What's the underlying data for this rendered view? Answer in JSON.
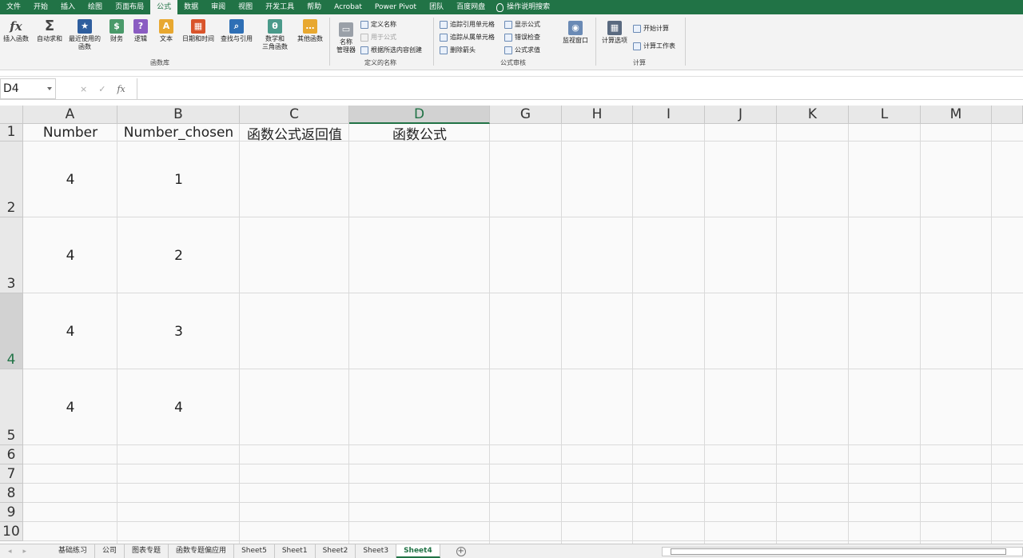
{
  "menubar": {
    "items": [
      "文件",
      "开始",
      "插入",
      "绘图",
      "页面布局",
      "公式",
      "数据",
      "审阅",
      "视图",
      "开发工具",
      "帮助",
      "Acrobat",
      "Power Pivot",
      "团队",
      "百度网盘"
    ],
    "active_index": 5,
    "tell_me": "操作说明搜索"
  },
  "ribbon": {
    "function_library": {
      "insert_function": "插入函数",
      "autosum": "自动求和",
      "recent_line1": "最近使用的",
      "recent_line2": "函数",
      "financial": "财务",
      "logical": "逻辑",
      "text": "文本",
      "datetime": "日期和时间",
      "lookup": "查找与引用",
      "math_line1": "数学和",
      "math_line2": "三角函数",
      "more": "其他函数",
      "group_label": "函数库"
    },
    "defined_names": {
      "name_manager_line1": "名称",
      "name_manager_line2": "管理器",
      "define_name": "定义名称",
      "use_in_formula": "用于公式",
      "create_from_selection": "根据所选内容创建",
      "group_label": "定义的名称"
    },
    "formula_auditing": {
      "trace_precedents": "追踪引用单元格",
      "trace_dependents": "追踪从属单元格",
      "remove_arrows": "删除箭头",
      "show_formulas": "显示公式",
      "error_checking": "错误检查",
      "evaluate_formula": "公式求值",
      "watch_window": "监视窗口",
      "group_label": "公式审核"
    },
    "calculation": {
      "calc_options": "计算选项",
      "calc_now": "开始计算",
      "calc_sheet": "计算工作表",
      "group_label": "计算"
    }
  },
  "formula_bar": {
    "name_box": "D4",
    "cancel_icon": "×",
    "enter_icon": "✓",
    "fx_label": "fx",
    "formula": ""
  },
  "grid": {
    "columns": [
      "A",
      "B",
      "C",
      "D",
      "G",
      "H",
      "I",
      "J",
      "K",
      "L",
      "M"
    ],
    "selected_column": "D",
    "rows": [
      "1",
      "2",
      "3",
      "4",
      "5",
      "6",
      "7",
      "8",
      "9",
      "10"
    ],
    "selected_row": "4",
    "cells": {
      "A1": "Number",
      "B1": "Number_chosen",
      "C1": "函数公式返回值",
      "D1": "函数公式",
      "A2": "4",
      "B2": "1",
      "A3": "4",
      "B3": "2",
      "A4": "4",
      "B4": "3",
      "A5": "4",
      "B5": "4"
    }
  },
  "sheets": {
    "tabs": [
      "基础练习",
      "公司",
      "图表专题",
      "函数专题偏应用",
      "Sheet5",
      "Sheet1",
      "Sheet2",
      "Sheet3",
      "Sheet4"
    ],
    "active": "Sheet4",
    "add_sheet": "+"
  },
  "colors": {
    "accent": "#217346",
    "ribbon_bg": "#f3f3f3",
    "grid_bg": "#fafafa"
  }
}
